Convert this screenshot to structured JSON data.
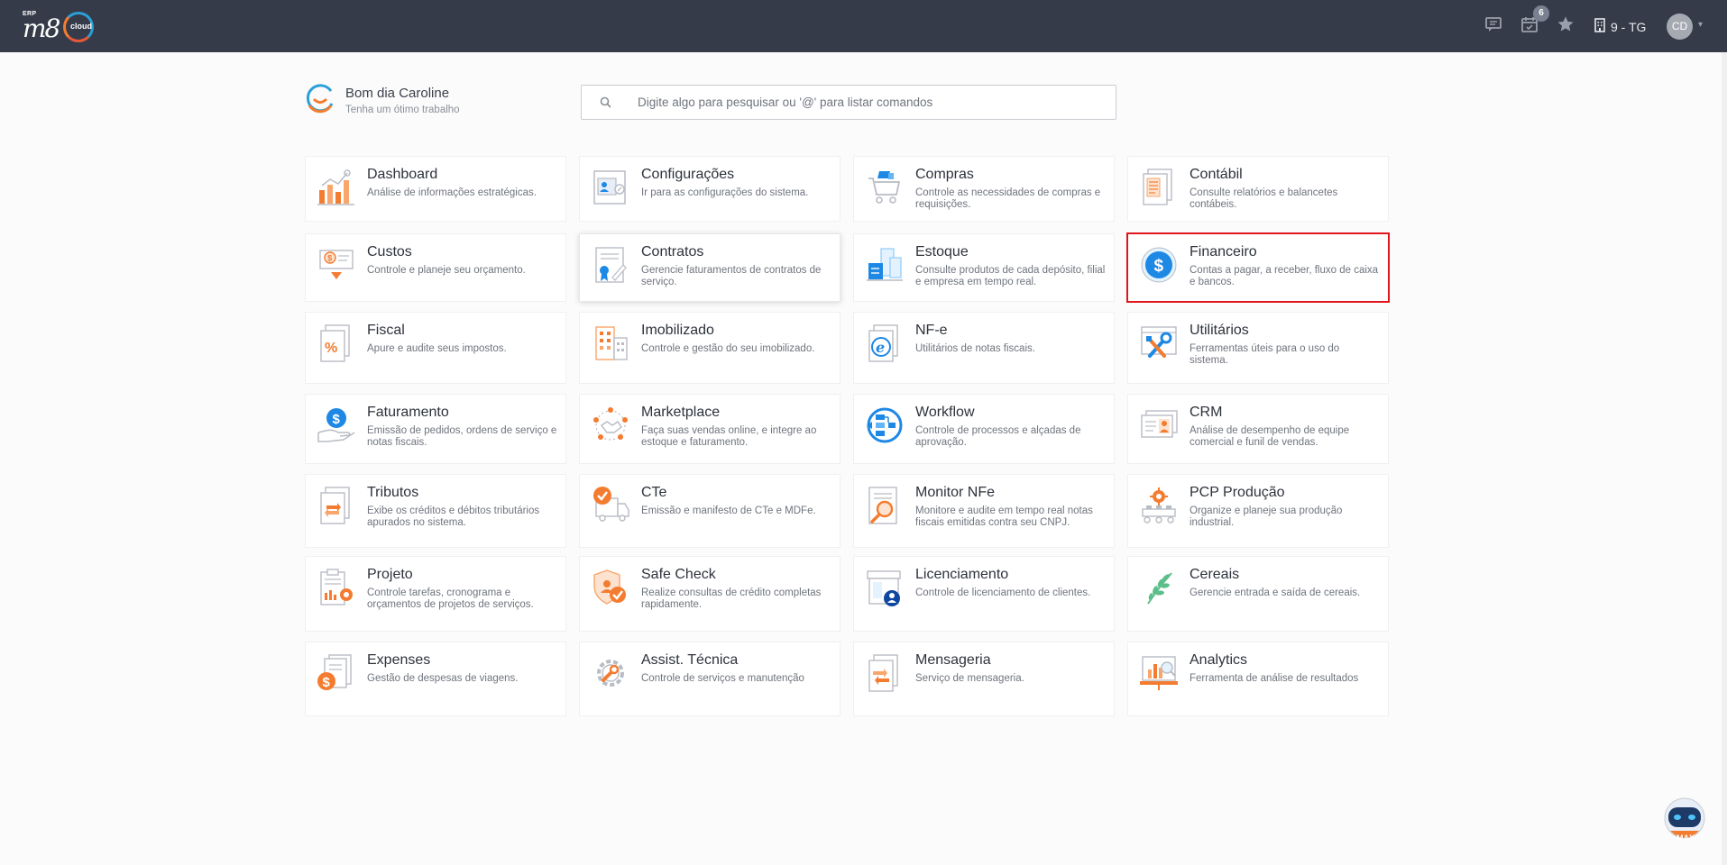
{
  "header": {
    "logo_erp": "ERP",
    "logo_mark": "m8",
    "logo_cloud": "cloud",
    "notification_count": "6",
    "company": "9 - TG",
    "user_initials": "CD",
    "background": "#353b48"
  },
  "greeting": {
    "title": "Bom dia Caroline",
    "subtitle": "Tenha um ótimo trabalho"
  },
  "search": {
    "placeholder": "Digite algo para pesquisar ou '@' para listar comandos"
  },
  "modules": [
    {
      "title": "Dashboard",
      "desc": "Análise de informações estratégicas.",
      "icon": "chart-icon"
    },
    {
      "title": "Configurações",
      "desc": "Ir para as configurações do sistema.",
      "icon": "settings-profile-icon"
    },
    {
      "title": "Compras",
      "desc": "Controle as necessidades de compras e requisições.",
      "icon": "shopping-cart-icon"
    },
    {
      "title": "Contábil",
      "desc": "Consulte relatórios e balancetes contábeis.",
      "icon": "ledger-icon"
    },
    {
      "title": "Custos",
      "desc": "Controle e planeje seu orçamento.",
      "icon": "cost-icon"
    },
    {
      "title": "Contratos",
      "desc": "Gerencie faturamentos de contratos de serviço.",
      "icon": "contract-icon"
    },
    {
      "title": "Estoque",
      "desc": "Consulte produtos de cada depósito, filial e empresa em tempo real.",
      "icon": "warehouse-icon"
    },
    {
      "title": "Financeiro",
      "desc": "Contas a pagar, a receber, fluxo de caixa e bancos.",
      "icon": "dollar-icon"
    },
    {
      "title": "Fiscal",
      "desc": "Apure e audite seus impostos.",
      "icon": "percent-document-icon"
    },
    {
      "title": "Imobilizado",
      "desc": "Controle e gestão do seu imobilizado.",
      "icon": "building-icon"
    },
    {
      "title": "NF-e",
      "desc": "Utilitários de notas fiscais.",
      "icon": "nfe-icon"
    },
    {
      "title": "Utilitários",
      "desc": "Ferramentas úteis para o uso do sistema.",
      "icon": "tools-icon"
    },
    {
      "title": "Faturamento",
      "desc": "Emissão de pedidos, ordens de serviço e notas fiscais.",
      "icon": "billing-icon"
    },
    {
      "title": "Marketplace",
      "desc": "Faça suas vendas online, e integre ao estoque e faturamento.",
      "icon": "handshake-icon"
    },
    {
      "title": "Workflow",
      "desc": "Controle de processos e alçadas de aprovação.",
      "icon": "workflow-icon"
    },
    {
      "title": "CRM",
      "desc": "Análise de desempenho de equipe comercial e funil de vendas.",
      "icon": "crm-icon"
    },
    {
      "title": "Tributos",
      "desc": "Exibe os créditos e débitos tributários apurados no sistema.",
      "icon": "transfer-document-icon"
    },
    {
      "title": "CTe",
      "desc": "Emissão e manifesto de CTe e MDFe.",
      "icon": "truck-check-icon"
    },
    {
      "title": "Monitor NFe",
      "desc": "Monitore e audite em tempo real notas fiscais emitidas contra seu CNPJ.",
      "icon": "magnifier-document-icon"
    },
    {
      "title": "PCP Produção",
      "desc": "Organize e planeje sua produção industrial.",
      "icon": "production-icon"
    },
    {
      "title": "Projeto",
      "desc": "Controle tarefas, cronograma e orçamentos de projetos de serviços.",
      "icon": "project-icon"
    },
    {
      "title": "Safe Check",
      "desc": "Realize consultas de crédito completas rapidamente.",
      "icon": "shield-check-icon"
    },
    {
      "title": "Licenciamento",
      "desc": "Controle de licenciamento de clientes.",
      "icon": "license-icon"
    },
    {
      "title": "Cereais",
      "desc": "Gerencie entrada e saída de cereais.",
      "icon": "leaf-icon"
    },
    {
      "title": "Expenses",
      "desc": "Gestão de despesas de viagens.",
      "icon": "expenses-icon"
    },
    {
      "title": "Assist. Técnica",
      "desc": "Controle de serviços e manutenção",
      "icon": "gear-icon"
    },
    {
      "title": "Mensageria",
      "desc": "Serviço de mensageria.",
      "icon": "messaging-icon"
    },
    {
      "title": "Analytics",
      "desc": "Ferramenta de análise de resultados",
      "icon": "analytics-icon"
    }
  ],
  "assistant": {
    "label": "MAX"
  },
  "colors": {
    "accent_orange": "#f47c30",
    "accent_blue": "#1e88e5",
    "selected_border": "#e0151c"
  }
}
